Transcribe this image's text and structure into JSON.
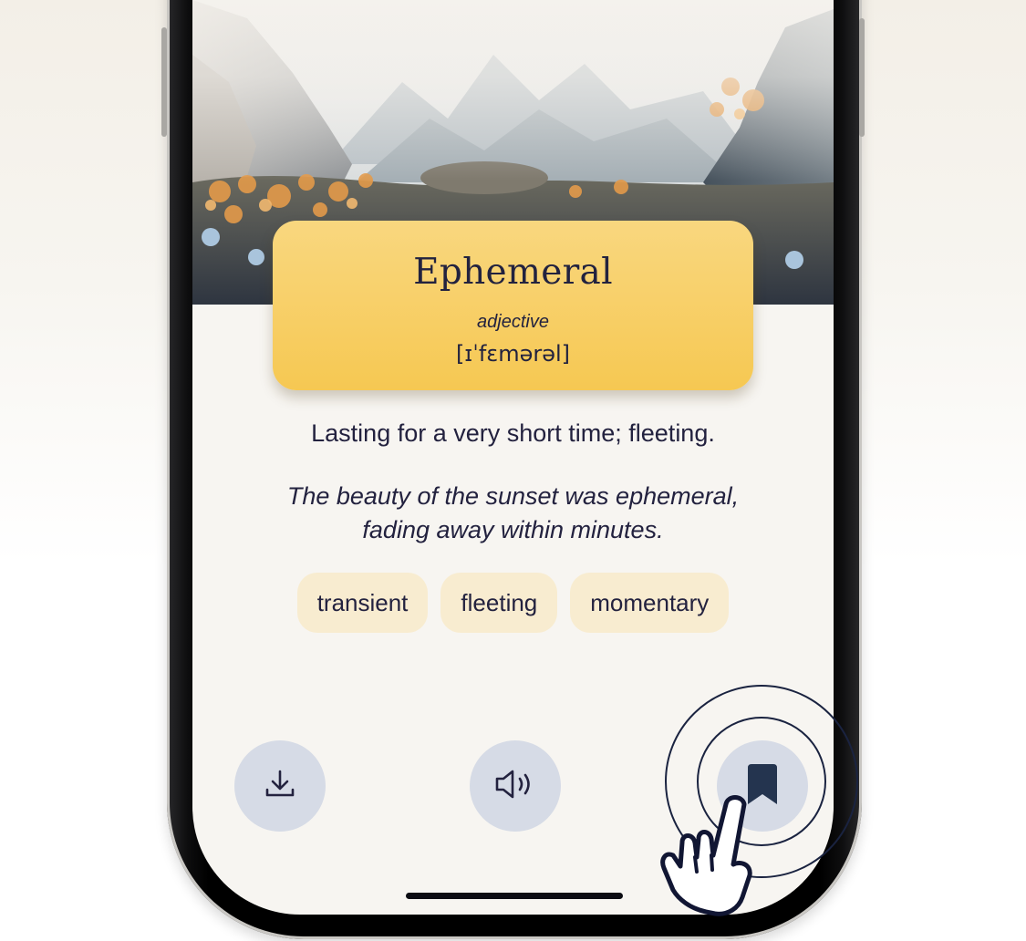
{
  "word": {
    "title": "Ephemeral",
    "part_of_speech": "adjective",
    "pronunciation": "[ɪˈfɛmərəl]"
  },
  "definition": "Lasting for a very short time; fleeting.",
  "example": {
    "line1": "The beauty of the sunset was ephemeral,",
    "line2": "fading away within minutes."
  },
  "synonyms": [
    "transient",
    "fleeting",
    "momentary"
  ],
  "actions": {
    "download_icon": "download-icon",
    "speaker_icon": "speaker-icon",
    "bookmark_icon": "bookmark-icon"
  },
  "colors": {
    "card": "#f6c852",
    "chip": "#f8ecd0",
    "action_button": "#d6dbe6",
    "text": "#23223f"
  }
}
